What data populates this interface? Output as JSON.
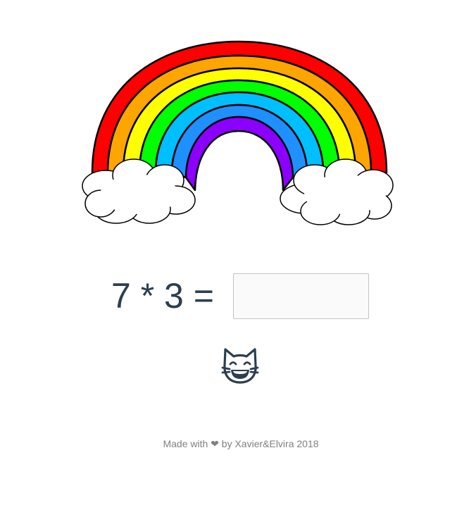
{
  "colors": {
    "text": "#2c3e50",
    "footer_text": "#808080",
    "input_border": "#c4c4c4",
    "input_background": "#fafafa",
    "rainbow_bands": [
      "#ff0000",
      "#ffa500",
      "#ffff00",
      "#00ff00",
      "#00bfff",
      "#1e90ff",
      "#8b00ff"
    ],
    "cloud": "#ffffff",
    "outline": "#000000"
  },
  "illustration": {
    "name": "rainbow-with-clouds"
  },
  "question": {
    "text": "7 * 3 ="
  },
  "answer": {
    "value": "",
    "placeholder": ""
  },
  "feedback": {
    "icon": "grinning-cat-icon"
  },
  "footer": {
    "text": "Made with ❤ by Xavier&Elvira 2018"
  }
}
